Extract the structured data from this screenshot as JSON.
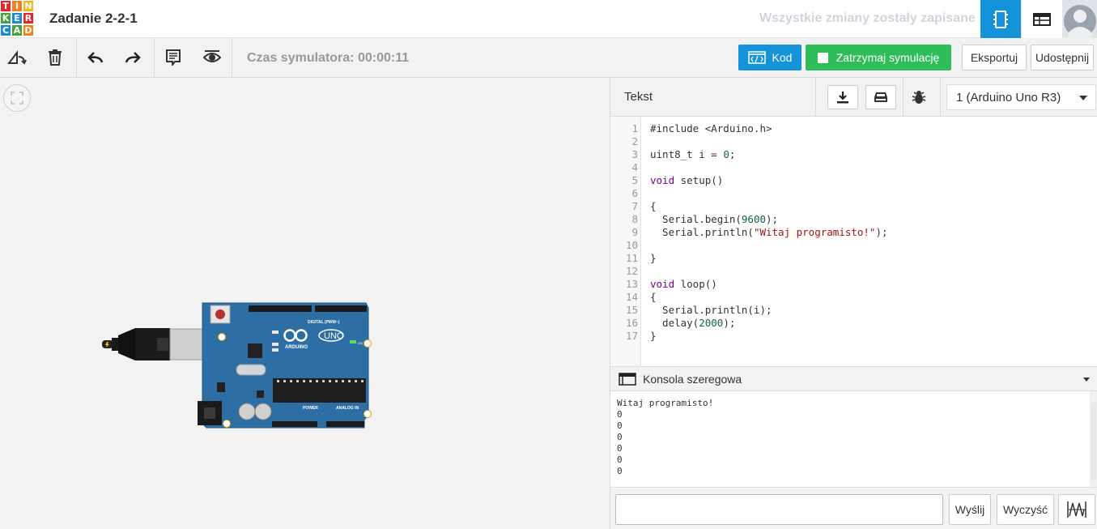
{
  "app": {
    "logo_letters": [
      "T",
      "I",
      "N",
      "K",
      "E",
      "R",
      "C",
      "A",
      "D"
    ],
    "logo_colors": [
      "#e3262e",
      "#f2811d",
      "#f2b51c",
      "#47a33c",
      "#1c8bd1",
      "#e3262e",
      "#1c8bd1",
      "#47a33c",
      "#f2811d"
    ],
    "project_title": "Zadanie 2-2-1",
    "save_status": "Wszystkie zmiany zostały zapisane",
    "accent_color": "#1493d9"
  },
  "topbar_icons": {
    "circuit_view": "circuit-view-icon",
    "list_view": "list-view-icon",
    "avatar": "user-avatar"
  },
  "toolbar": {
    "rotate": "rotate-icon",
    "delete": "trash-icon",
    "undo": "undo-icon",
    "redo": "redo-icon",
    "notes": "notes-icon",
    "visibility": "eye-icon",
    "sim_time": "Czas symulatora: 00:00:11",
    "code_label": "Kod",
    "stop_label": "Zatrzymaj symulację",
    "export_label": "Eksportuj",
    "share_label": "Udostępnij",
    "stop_color": "#2ebd59"
  },
  "canvas": {
    "fit_icon": "fit-view-icon",
    "component": "Arduino Uno R3",
    "board_labels": {
      "brand": "ARDUINO",
      "model": "UNO",
      "digital": "DIGITAL (PWM~)",
      "power": "POWER",
      "analog": "ANALOG IN",
      "on": "ON"
    }
  },
  "code_panel": {
    "mode": "Tekst",
    "download_icon": "download-icon",
    "upload_icon": "upload-icon",
    "debug_icon": "bug-icon",
    "device": "1 (Arduino Uno R3)",
    "lines": [
      [
        {
          "t": "#include <Arduino.h>",
          "c": ""
        }
      ],
      [
        {
          "t": "",
          "c": ""
        }
      ],
      [
        {
          "t": "uint8_t i = ",
          "c": ""
        },
        {
          "t": "0",
          "c": "num"
        },
        {
          "t": ";",
          "c": ""
        }
      ],
      [
        {
          "t": "",
          "c": ""
        }
      ],
      [
        {
          "t": "void",
          "c": "kw"
        },
        {
          "t": " setup()",
          "c": ""
        }
      ],
      [
        {
          "t": "",
          "c": ""
        }
      ],
      [
        {
          "t": "{",
          "c": ""
        }
      ],
      [
        {
          "t": "  Serial.begin(",
          "c": ""
        },
        {
          "t": "9600",
          "c": "num"
        },
        {
          "t": ");",
          "c": ""
        }
      ],
      [
        {
          "t": "  Serial.println(",
          "c": ""
        },
        {
          "t": "\"Witaj programisto!\"",
          "c": "str"
        },
        {
          "t": ");",
          "c": ""
        }
      ],
      [
        {
          "t": "",
          "c": ""
        }
      ],
      [
        {
          "t": "}",
          "c": ""
        }
      ],
      [
        {
          "t": "",
          "c": ""
        }
      ],
      [
        {
          "t": "void",
          "c": "kw"
        },
        {
          "t": " loop()",
          "c": ""
        }
      ],
      [
        {
          "t": "{",
          "c": ""
        }
      ],
      [
        {
          "t": "  Serial.println(i);",
          "c": ""
        }
      ],
      [
        {
          "t": "  delay(",
          "c": ""
        },
        {
          "t": "2000",
          "c": "num"
        },
        {
          "t": ");",
          "c": ""
        }
      ],
      [
        {
          "t": "}",
          "c": ""
        }
      ]
    ]
  },
  "serial": {
    "title": "Konsola szeregowa",
    "output": [
      "Witaj programisto!",
      "0",
      "0",
      "0",
      "0",
      "0",
      "0"
    ],
    "input_value": "",
    "send_label": "Wyślij",
    "clear_label": "Wyczyść",
    "graph_icon": "graph-icon"
  }
}
